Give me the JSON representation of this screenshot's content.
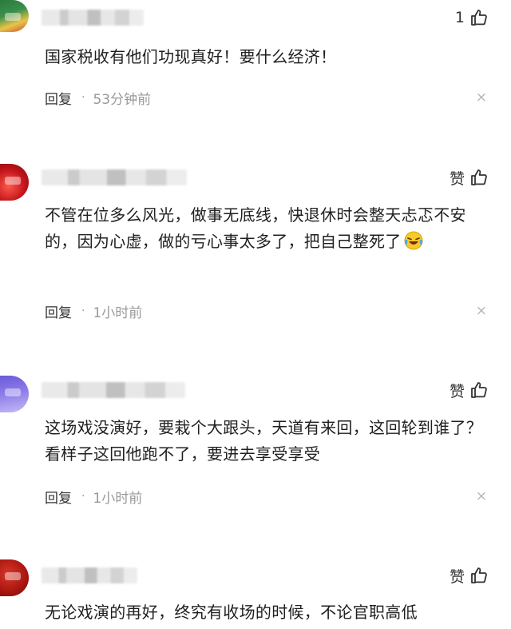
{
  "comments": [
    {
      "likes": "1",
      "text": "国家税收有他们功现真好！要什么经济！",
      "reply_label": "回复",
      "separator": "·",
      "time": "53分钟前",
      "close": "×"
    },
    {
      "likes": "赞",
      "text": "不管在位多么风光，做事无底线，快退休时会整天忐忑不安的，因为心虚，做的亏心事太多了，把自己整死了",
      "emoji": "laughing-crying-emoji",
      "reply_label": "回复",
      "separator": "·",
      "time": "1小时前",
      "close": "×"
    },
    {
      "likes": "赞",
      "text": "这场戏没演好，要栽个大跟头，天道有来回，这回轮到谁了？看样子这回他跑不了，要进去享受享受",
      "reply_label": "回复",
      "separator": "·",
      "time": "1小时前",
      "close": "×"
    },
    {
      "likes": "赞",
      "text": "无论戏演的再好，终究有收场的时候，不论官职高低"
    }
  ],
  "icons": {
    "like": "thumbs-up-icon",
    "close": "close-icon"
  },
  "colors": {
    "meta_text": "#999999",
    "body_text": "#1f1f1f",
    "close": "#b5b5b5"
  }
}
